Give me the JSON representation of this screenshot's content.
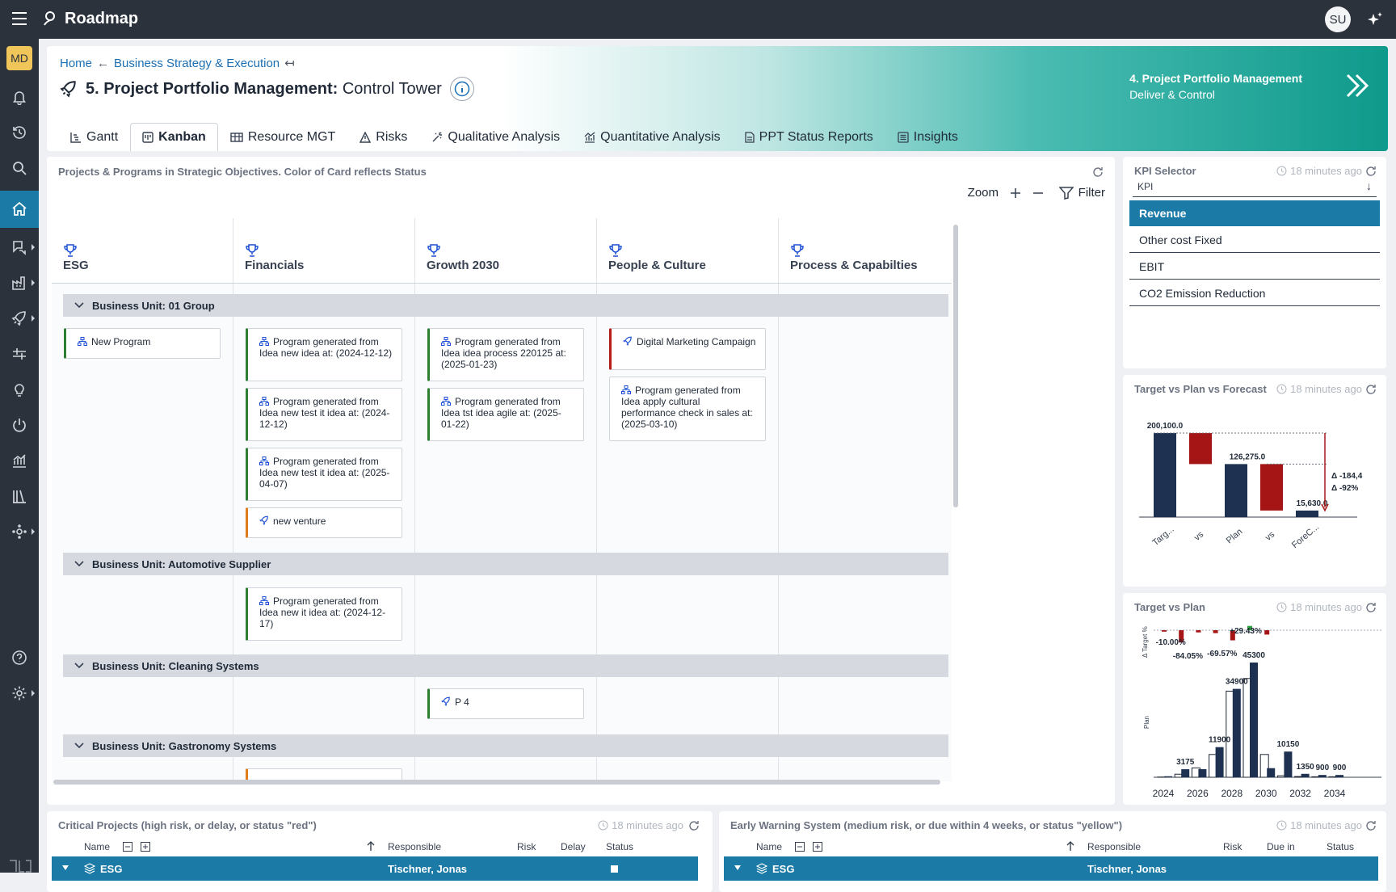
{
  "app": {
    "title": "Roadmap",
    "user_initials": "SU",
    "workspace_initials": "MD"
  },
  "header": {
    "breadcrumb": {
      "home": "Home",
      "parent": "Business Strategy & Execution"
    },
    "title_bold": "5. Project Portfolio Management:",
    "title_rest": "Control Tower",
    "next_title": "4. Project Portfolio Management",
    "next_subtitle": "Deliver & Control"
  },
  "tabs": [
    {
      "label": "Gantt",
      "icon": "gantt-icon"
    },
    {
      "label": "Kanban",
      "icon": "kanban-icon",
      "active": true
    },
    {
      "label": "Resource MGT",
      "icon": "resource-icon"
    },
    {
      "label": "Risks",
      "icon": "warning-icon"
    },
    {
      "label": "Qualitative Analysis",
      "icon": "wand-icon"
    },
    {
      "label": "Quantitative Analysis",
      "icon": "chart-icon"
    },
    {
      "label": "PPT Status Reports",
      "icon": "document-icon"
    },
    {
      "label": "Insights",
      "icon": "list-icon"
    }
  ],
  "kanban": {
    "caption": "Projects & Programs in Strategic Objectives. Color of Card reflects Status",
    "zoom_label": "Zoom",
    "filter_label": "Filter",
    "columns": [
      "ESG",
      "Financials",
      "Growth 2030",
      "People & Culture",
      "Process & Capabilties"
    ],
    "business_units": [
      "Business Unit: 01 Group",
      "Business Unit: Automotive Supplier",
      "Business Unit: Cleaning Systems",
      "Business Unit: Gastronomy Systems"
    ],
    "cards": [
      "New Program",
      "Program generated from Idea new idea at: (2024-12-12)",
      "Program generated from Idea new test it idea at: (2024-12-12)",
      "Program generated from Idea new test it idea at: (2025-04-07)",
      "new venture",
      "Program generated from Idea idea process 220125 at: (2025-01-23)",
      "Program generated from Idea tst idea agile at: (2025-01-22)",
      "Digital Marketing Campaign",
      "Program generated from Idea apply cultural performance check in sales at: (2025-03-10)",
      "Program generated from Idea new it idea at: (2024-12-17)",
      "P 4"
    ],
    "status_colors": {
      "green": "#2e7d32",
      "orange": "#e07b1a",
      "red": "#b71c1c"
    }
  },
  "kpi_selector": {
    "title": "KPI Selector",
    "timestamp": "18 minutes ago",
    "field_label": "KPI",
    "options": [
      "Revenue",
      "Other cost Fixed",
      "EBIT",
      "CO2 Emission Reduction"
    ],
    "selected": "Revenue"
  },
  "target_plan_forecast": {
    "title": "Target vs Plan vs Forecast",
    "timestamp": "18 minutes ago",
    "delta_abs": "Δ -184,4",
    "delta_pct": "Δ -92%"
  },
  "target_plan": {
    "title": "Target vs Plan",
    "timestamp": "18 minutes ago",
    "y1_label": "Δ Target %",
    "y2_label": "Plan"
  },
  "chart_data": [
    {
      "type": "bar",
      "title": "Target vs Plan vs Forecast",
      "categories": [
        "Targ...",
        "vs",
        "Plan",
        "vs",
        "ForeC..."
      ],
      "values": [
        200100.0,
        -73825.0,
        126275.0,
        -110645.0,
        15630.0
      ],
      "labels": [
        "200,100.0",
        "",
        "126,275.0",
        "",
        "15,630.0"
      ],
      "ylim": [
        0,
        200100
      ]
    },
    {
      "type": "bar",
      "title": "Target vs Plan",
      "x": [
        2024,
        2025,
        2026,
        2027,
        2028,
        2029,
        2030,
        2031,
        2032,
        2033,
        2034
      ],
      "x_ticks": [
        "2024",
        "2026",
        "2028",
        "2030",
        "2032",
        "2034"
      ],
      "series": [
        {
          "name": "Target",
          "values": [
            100,
            1200,
            3700,
            9000,
            34000,
            39000,
            9000,
            600,
            300,
            200,
            200
          ]
        },
        {
          "name": "Plan",
          "values": [
            400,
            3175,
            3200,
            11900,
            34900,
            45300,
            3600,
            10150,
            1350,
            900,
            900
          ]
        }
      ],
      "delta_pct": [
        -10.0,
        -84.05,
        -15.0,
        -20.0,
        -69.57,
        29.43,
        -30.0,
        0,
        0,
        0,
        0
      ],
      "value_labels": [
        "3175",
        "11900",
        "34900",
        "45300",
        "10150",
        "1350",
        "900",
        "900"
      ],
      "delta_labels": [
        "-10.00%",
        "-84.05%",
        "-69.57%",
        "+29.43%"
      ],
      "ylim": [
        0,
        45300
      ]
    }
  ],
  "critical": {
    "title": "Critical Projects (high risk, or delay, or status \"red\")",
    "timestamp": "18 minutes ago",
    "columns": [
      "Name",
      "Responsible",
      "Risk",
      "Delay",
      "Status"
    ],
    "row": {
      "name": "ESG",
      "responsible": "Tischner, Jonas"
    }
  },
  "early_warning": {
    "title": "Early Warning System (medium risk, or due within 4 weeks, or status \"yellow\")",
    "timestamp": "18 minutes ago",
    "columns": [
      "Name",
      "Responsible",
      "Risk",
      "Due in",
      "Status"
    ],
    "row": {
      "name": "ESG",
      "responsible": "Tischner, Jonas"
    }
  }
}
